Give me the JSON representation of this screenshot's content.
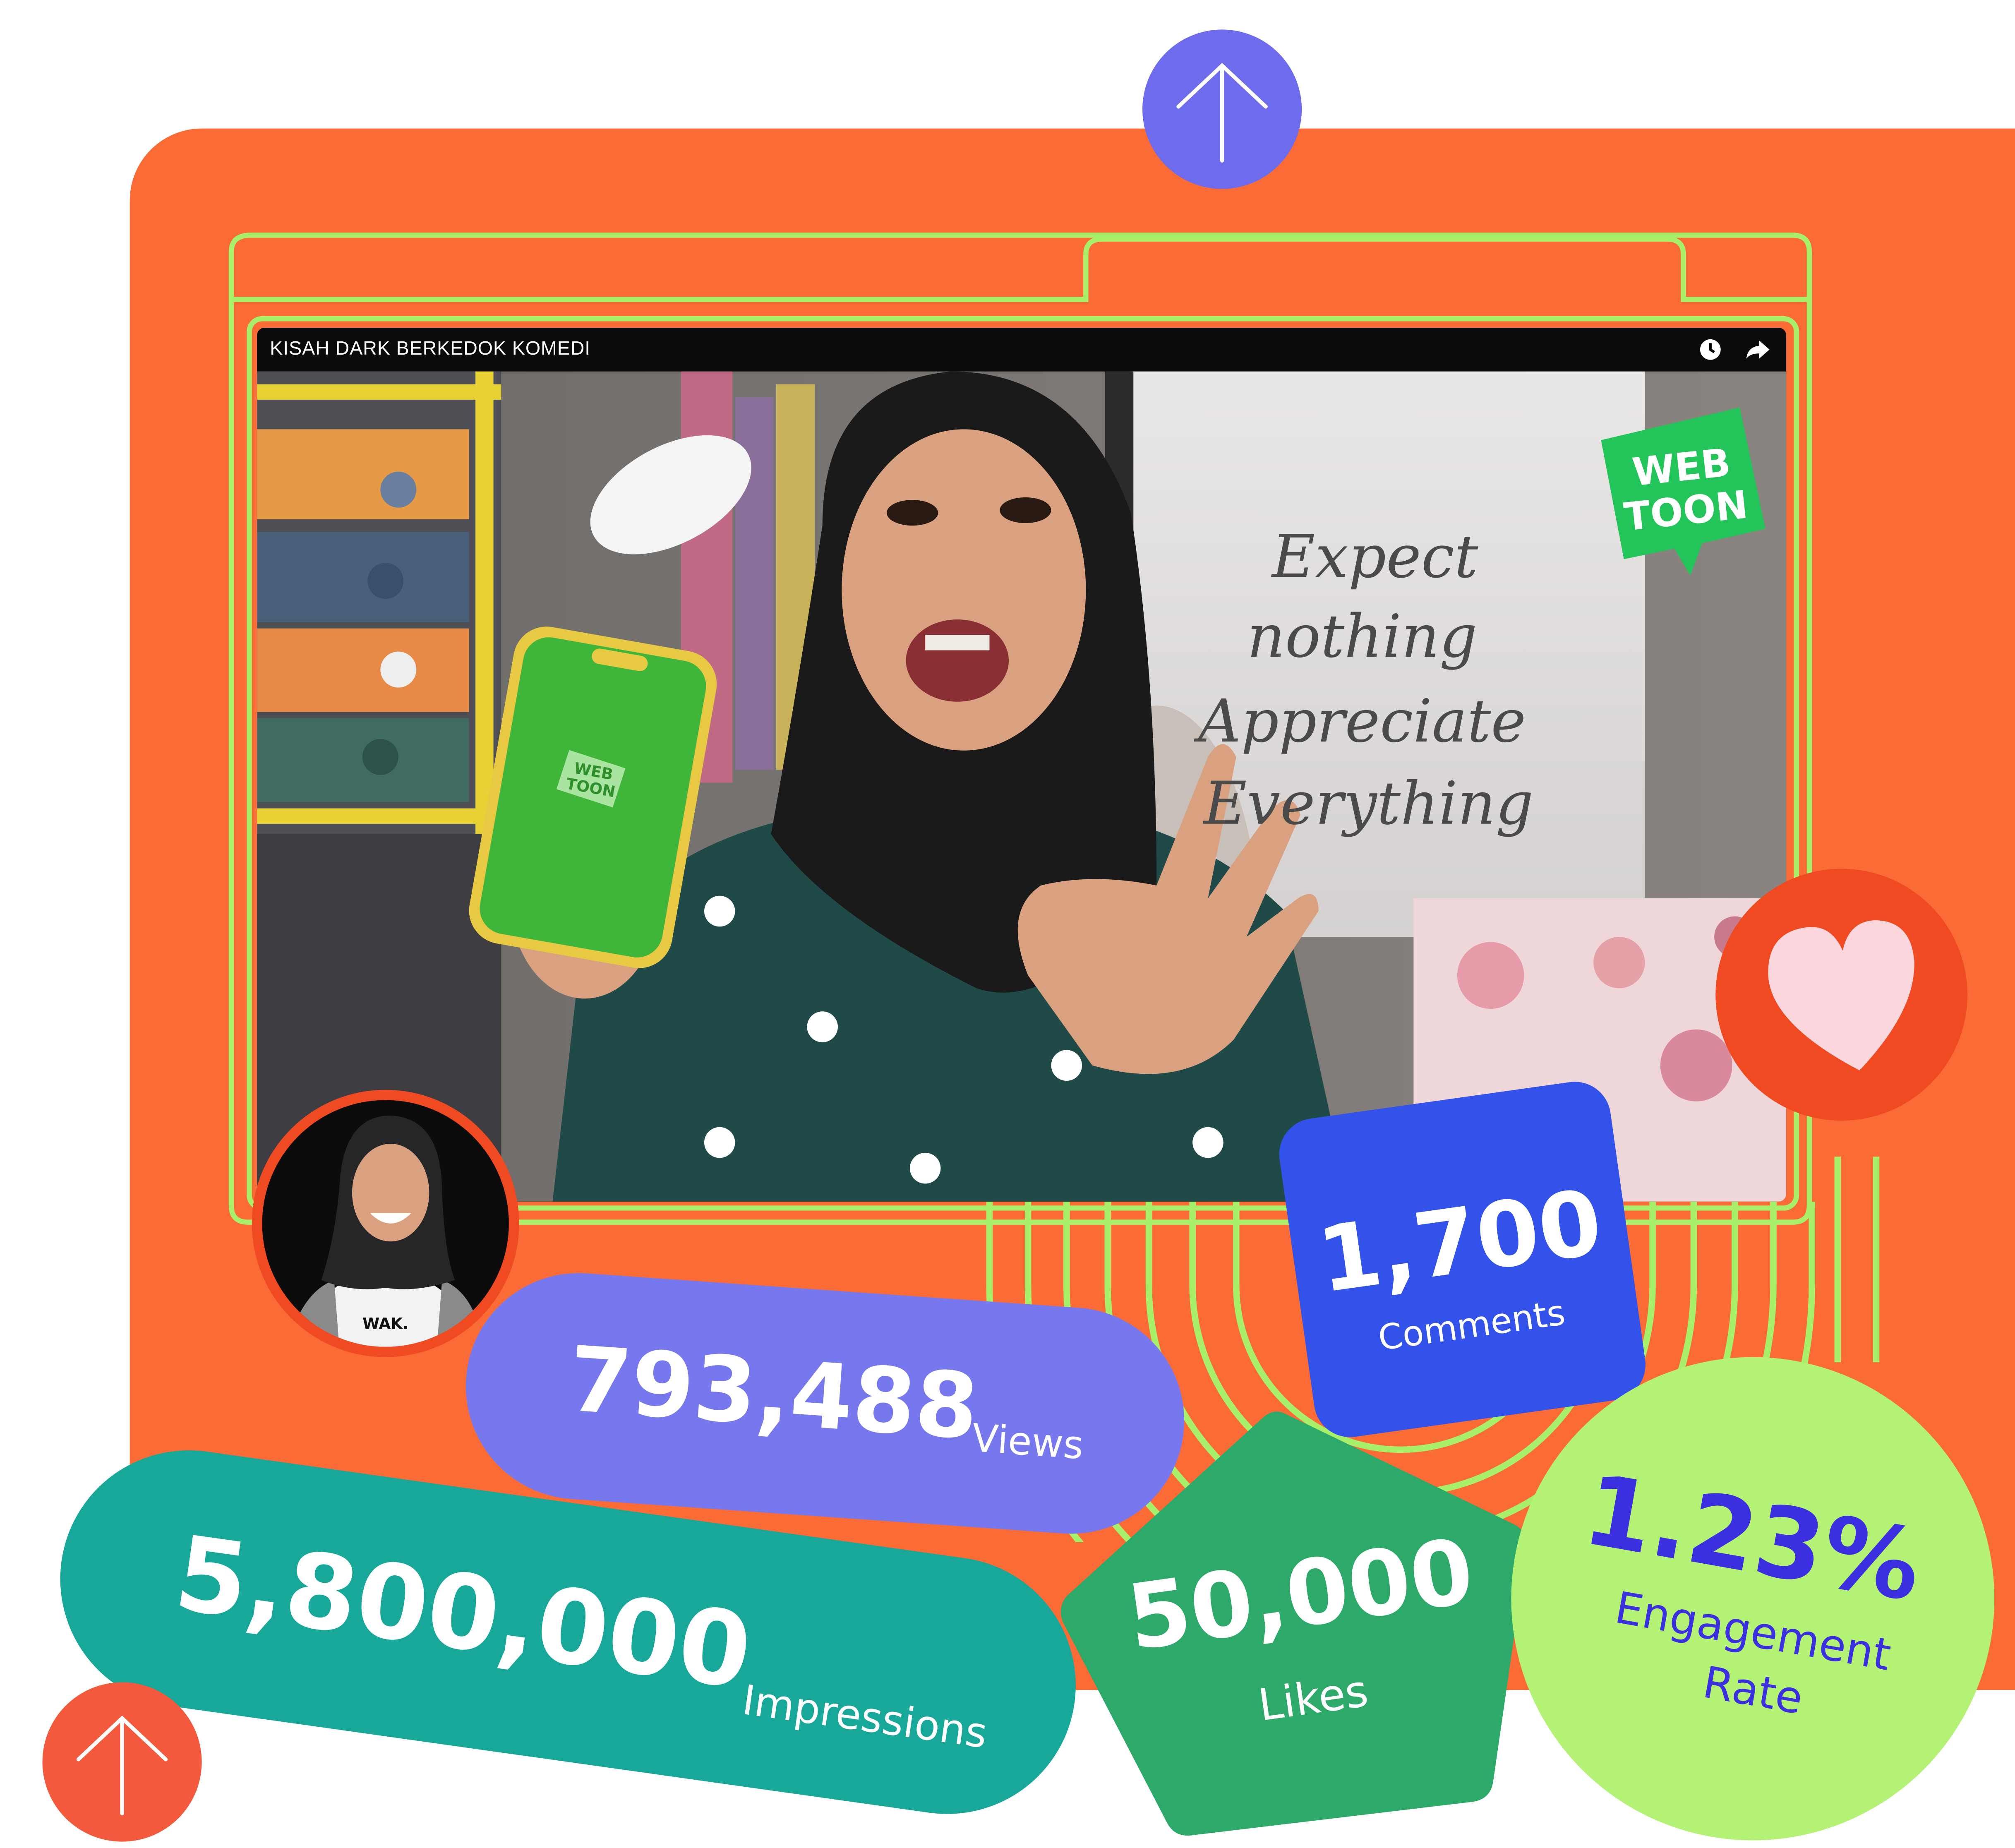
{
  "video": {
    "title": "KISAH DARK BERKEDOK KOMEDI",
    "logo_line1": "WEB",
    "logo_line2": "TOON",
    "poster_line1": "Expect",
    "poster_line2": "nothing",
    "poster_line3": "Appreciate",
    "poster_line4": "Everything",
    "phone_logo_line1": "WEB",
    "phone_logo_line2": "TOON",
    "shirt_text": "WAK."
  },
  "stats": {
    "comments": {
      "value": "1,700",
      "label": "Comments"
    },
    "views": {
      "value": "793,488",
      "label": "Views"
    },
    "impressions": {
      "value": "5,800,000",
      "label": "Impressions"
    },
    "likes": {
      "value": "50,000",
      "label": "Likes"
    },
    "engagement": {
      "value": "1.23%",
      "label_line1": "Engagement",
      "label_line2": "Rate"
    }
  },
  "colors": {
    "orange": "#fb6b36",
    "lime": "#a8ef6a",
    "purple_pill": "#7878ee",
    "teal_pill": "#17a899",
    "blue_card": "#3352ea",
    "green_pentagon": "#2daa6a",
    "lime_circle": "#b4f275",
    "up_arrow_purple": "#6e6cec",
    "up_arrow_red": "#f35a3d",
    "heart_bg": "#ef4a22",
    "heart_fill": "#fbd6dc"
  },
  "icons": [
    "up-arrow-icon",
    "heart-icon",
    "clock-icon",
    "share-icon"
  ]
}
